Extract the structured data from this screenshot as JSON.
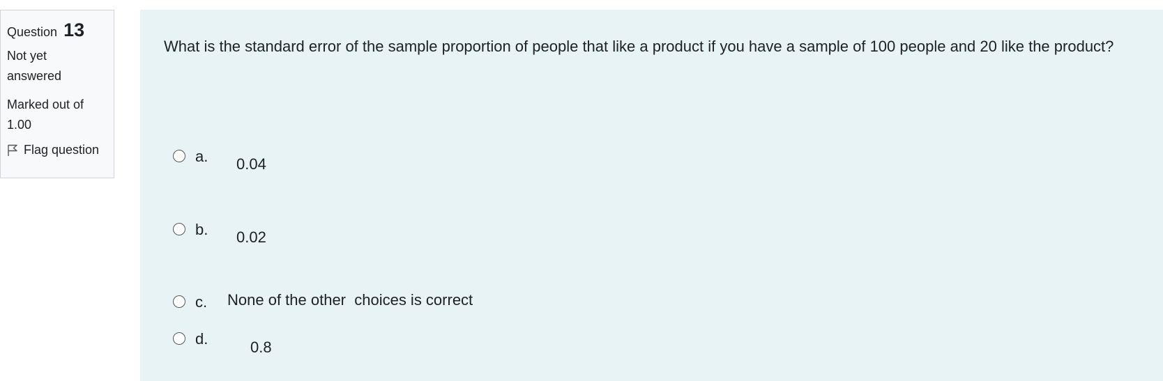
{
  "info": {
    "question_label": "Question",
    "question_number": "13",
    "state": "Not yet answered",
    "grade": "Marked out of 1.00",
    "flag_label": "Flag question"
  },
  "question": {
    "text": "What is the standard error of the sample proportion of people that like a product if you have a sample of 100 people and 20 like the product?"
  },
  "options": [
    {
      "letter": "a.",
      "value": "0.04",
      "selected": false
    },
    {
      "letter": "b.",
      "value": "0.02",
      "selected": false
    },
    {
      "letter": "c.",
      "value": "None of the other  choices is correct",
      "selected": false
    },
    {
      "letter": "d.",
      "value": "0.8",
      "selected": false
    }
  ],
  "colors": {
    "info_bg": "#f8f9fa",
    "content_bg": "#e7f3f5",
    "text": "#1d2125"
  },
  "icons": {
    "flag": "flag-outline-icon",
    "radio": "radio-unchecked-icon"
  }
}
